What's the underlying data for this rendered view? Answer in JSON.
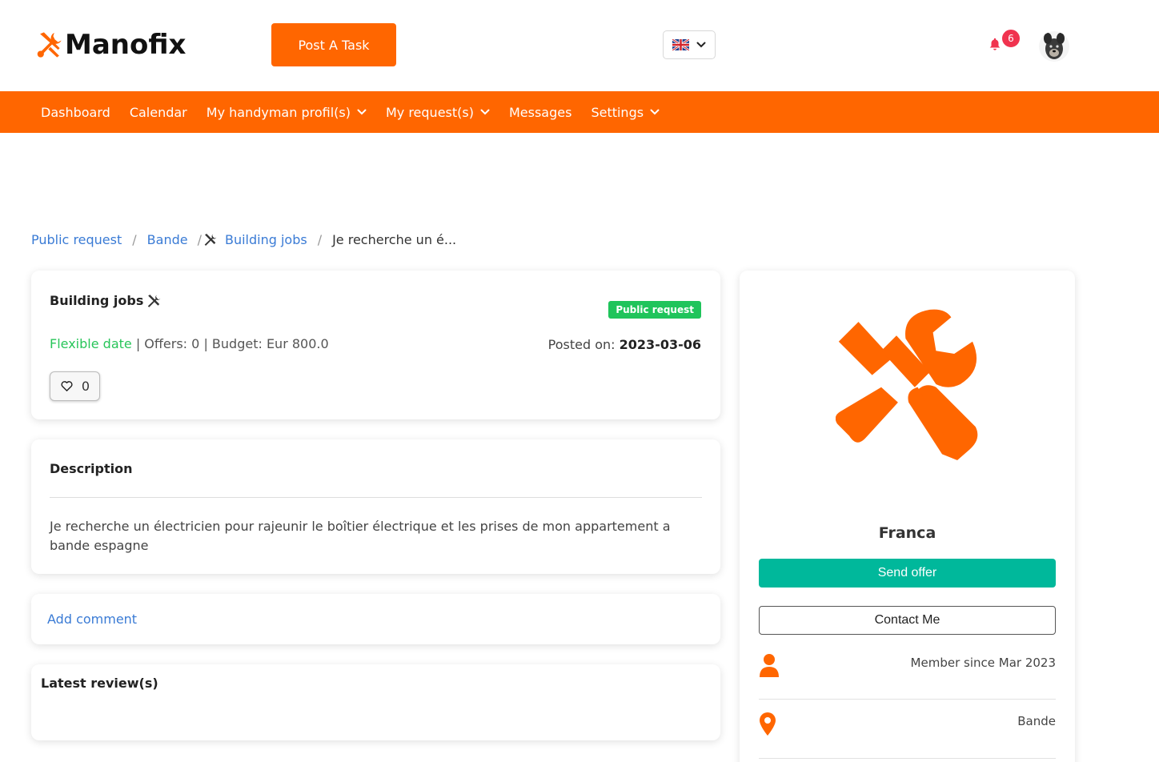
{
  "brand": {
    "name": "Manofix",
    "accent": "#ff6600"
  },
  "header": {
    "post_task_label": "Post A Task",
    "language_flag": "uk-flag-icon",
    "notification_count": "6"
  },
  "nav": {
    "items": [
      {
        "label": "Dashboard"
      },
      {
        "label": "Calendar"
      },
      {
        "label": "My handyman profil(s)"
      },
      {
        "label": "My request(s)"
      },
      {
        "label": "Messages"
      },
      {
        "label": "Settings"
      }
    ]
  },
  "breadcrumb": {
    "items": [
      "Public request",
      "Bande",
      "Building jobs"
    ],
    "current": "Je recherche un é..."
  },
  "request": {
    "category": "Building jobs",
    "status_badge": "Public request",
    "date_flex": "Flexible date",
    "offers": "| Offers: 0",
    "budget": "| Budget: Eur 800.0",
    "posted_label": "Posted on:",
    "posted_date": "2023-03-06",
    "likes": "0"
  },
  "description": {
    "title": "Description",
    "text": "Je recherche un électricien pour rajeunir le boîtier électrique et les prises de mon appartement a bande espagne"
  },
  "comments": {
    "add_label": "Add comment"
  },
  "reviews": {
    "title": "Latest review(s)"
  },
  "profile": {
    "name": "Franca",
    "send_offer_label": "Send offer",
    "contact_label": "Contact Me",
    "member_since": "Member since Mar 2023",
    "location": "Bande"
  },
  "colors": {
    "orange": "#ff6600",
    "teal": "#00b89b",
    "green": "#1fc45b",
    "link": "#3a7bd5",
    "badge_red": "#f0334f"
  }
}
